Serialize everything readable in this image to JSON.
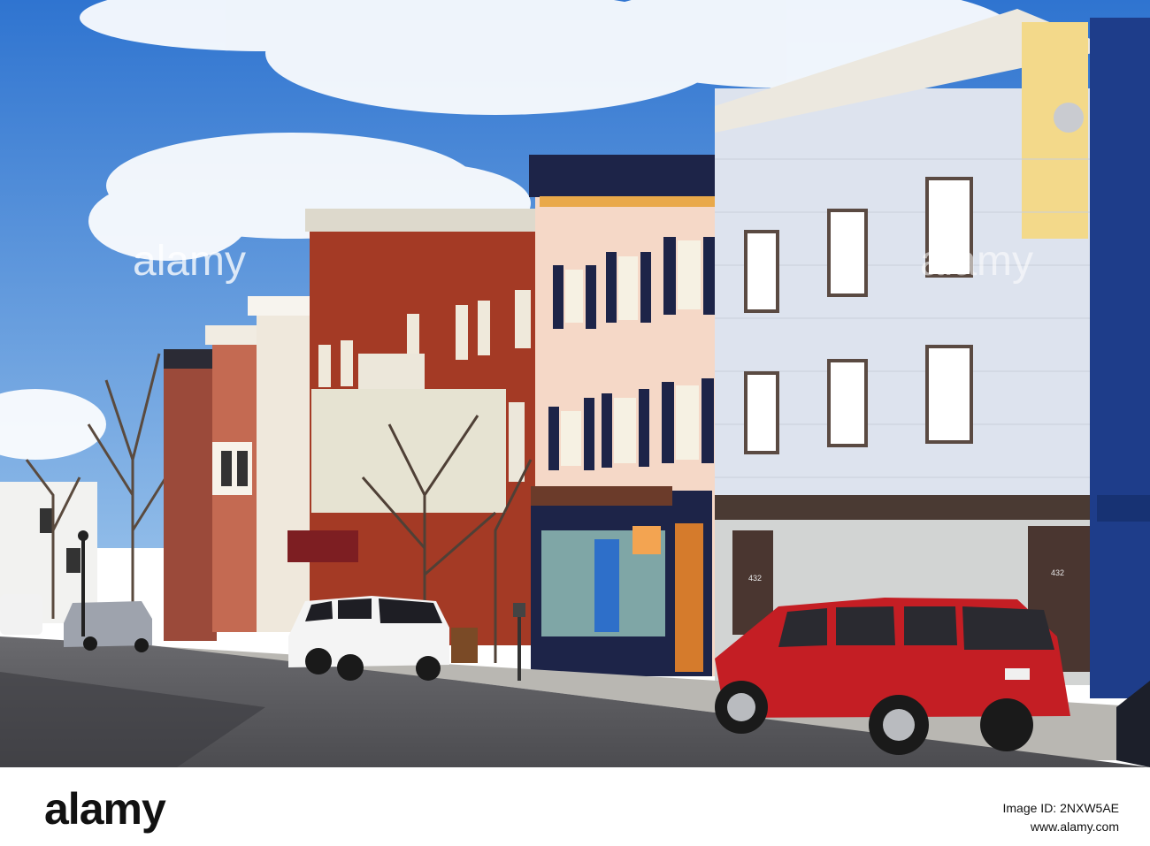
{
  "watermark": {
    "text": "alamy"
  },
  "footer": {
    "brand": "alamy",
    "image_id_label": "Image ID: 2NXW5AE",
    "site": "www.alamy.com"
  },
  "signage": {
    "door_number_left": "432",
    "door_number_right": "432"
  },
  "scene": {
    "sky_color": "#4f8fd8",
    "road_color": "#5b5b5e",
    "red_car_color": "#c41e24",
    "white_car_color": "#f4f4f4"
  }
}
